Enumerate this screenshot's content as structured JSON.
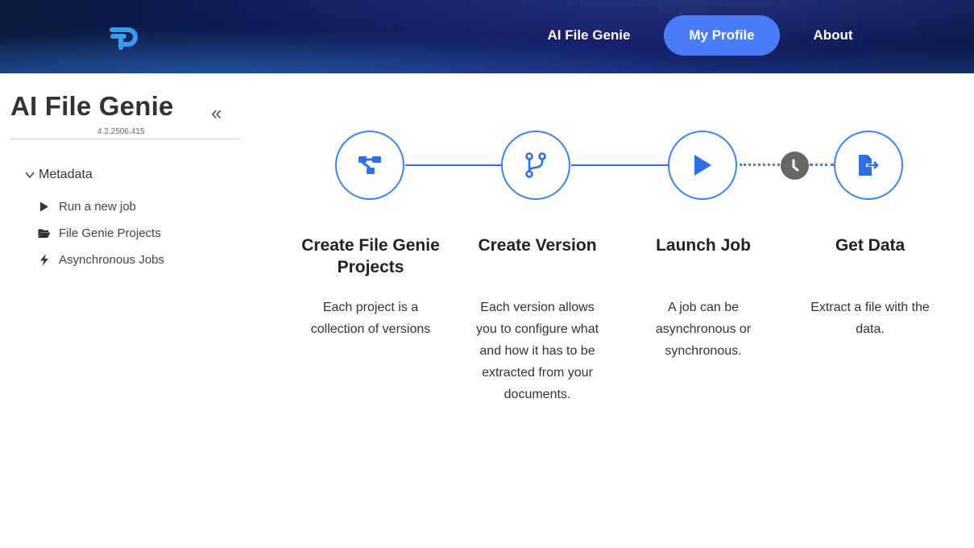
{
  "header": {
    "logo": "P-logo",
    "nav": [
      {
        "label": "AI File Genie"
      },
      {
        "label": "My Profile"
      },
      {
        "label": "About"
      }
    ],
    "active_color": "#4a7dfa"
  },
  "sidebar": {
    "title": "AI File Genie",
    "version": "4.2.2506.415",
    "collapse_glyph": "«",
    "section": {
      "label": "Metadata",
      "icon": "chevron-down-icon"
    },
    "items": [
      {
        "label": "Run a new job",
        "icon": "play-icon"
      },
      {
        "label": "File Genie Projects",
        "icon": "folder-open-icon"
      },
      {
        "label": "Asynchronous Jobs",
        "icon": "bolt-icon"
      }
    ]
  },
  "steps": [
    {
      "title": "Create File Genie Projects",
      "desc": "Each project is a collection of versions",
      "icon": "project-diagram-icon"
    },
    {
      "title": "Create Version",
      "desc": "Each version allows you to configure what and how it has to be extracted from your documents.",
      "icon": "code-branch-icon"
    },
    {
      "title": "Launch Job",
      "desc": "A job can be asynchronous or synchronous.",
      "icon": "play-icon"
    },
    {
      "title": "Get Data",
      "desc": "Extract a file with the data.",
      "icon": "file-export-icon"
    }
  ],
  "accent": "#3b82f6"
}
